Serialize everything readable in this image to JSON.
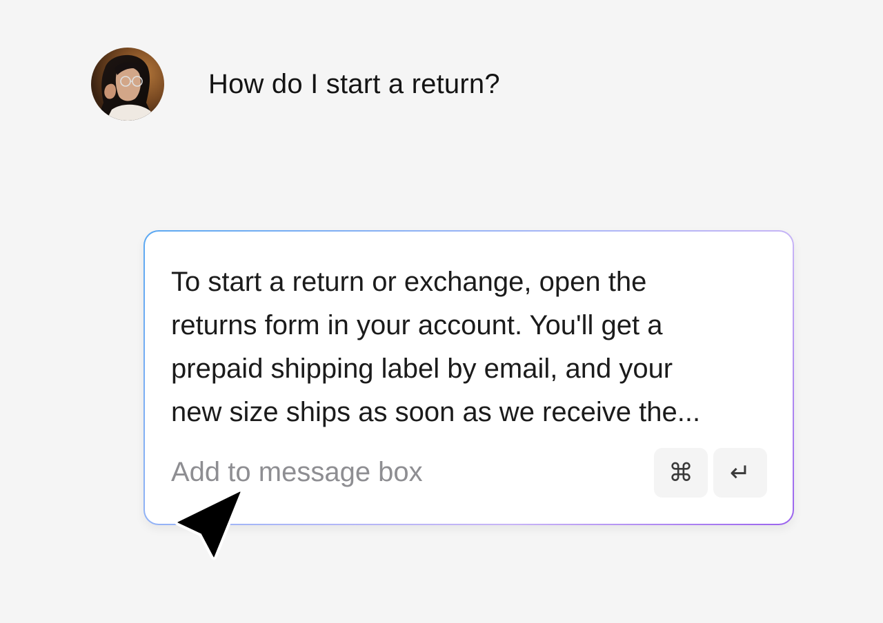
{
  "user_message": {
    "text": "How do I start a return?"
  },
  "reply": {
    "lines": [
      "To start a return or exchange, open the",
      "returns form in your account. You'll get a",
      "prepaid shipping label by email, and your",
      "new size ships as soon as we receive the..."
    ]
  },
  "composer": {
    "placeholder": "Add to message box",
    "value": ""
  },
  "shortcut_keys": {
    "command": "⌘",
    "enter": "↵"
  },
  "icons": {
    "avatar": "user-avatar",
    "command": "command-key-icon",
    "enter": "enter-key-icon",
    "pointer": "mouse-pointer-icon"
  },
  "colors": {
    "background": "#f5f5f5",
    "card_border_start": "#5aa8f2",
    "card_border_end": "#9a62ee",
    "text": "#161616",
    "placeholder": "#8e8e92"
  }
}
